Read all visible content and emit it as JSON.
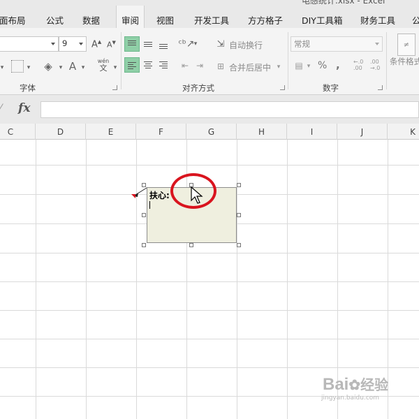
{
  "window": {
    "title": "电感统计.xlsx - Excel"
  },
  "tabs": [
    {
      "label": "面布局"
    },
    {
      "label": "公式"
    },
    {
      "label": "数据"
    },
    {
      "label": "审阅"
    },
    {
      "label": "视图"
    },
    {
      "label": "开发工具"
    },
    {
      "label": "方方格子"
    },
    {
      "label": "DIY工具箱"
    },
    {
      "label": "财务工具"
    },
    {
      "label": "公"
    }
  ],
  "ribbon": {
    "font_group": {
      "label": "字体",
      "font_name_value": "",
      "font_size_value": "9",
      "grow_font": "A",
      "shrink_font": "A",
      "font_color_glyph": "A",
      "phonetic_top": "wén",
      "phonetic_bottom": "文"
    },
    "align_group": {
      "label": "对齐方式",
      "wrap_text_label": "自动换行",
      "merge_center_label": "合并后居中"
    },
    "number_group": {
      "label": "数字",
      "number_format_value": "常规",
      "percent_glyph": "%",
      "comma_glyph": ",",
      "inc_decimal": ".00",
      "dec_decimal": ".00"
    },
    "styles_group": {
      "conditional_format_label": "条件格式"
    }
  },
  "formula_bar": {
    "fx_label": "fx",
    "value": ""
  },
  "columns": [
    "C",
    "D",
    "E",
    "F",
    "G",
    "H",
    "I",
    "J",
    "K"
  ],
  "comment": {
    "text": "扶心:"
  },
  "watermark": {
    "brand": "Bai",
    "brand_suffix": "经验",
    "domain": "jingyan.baidu.com"
  },
  "colors": {
    "accent_green": "#8fcfa7",
    "annotation_red": "#d9141e",
    "comment_bg": "#efefdf"
  }
}
